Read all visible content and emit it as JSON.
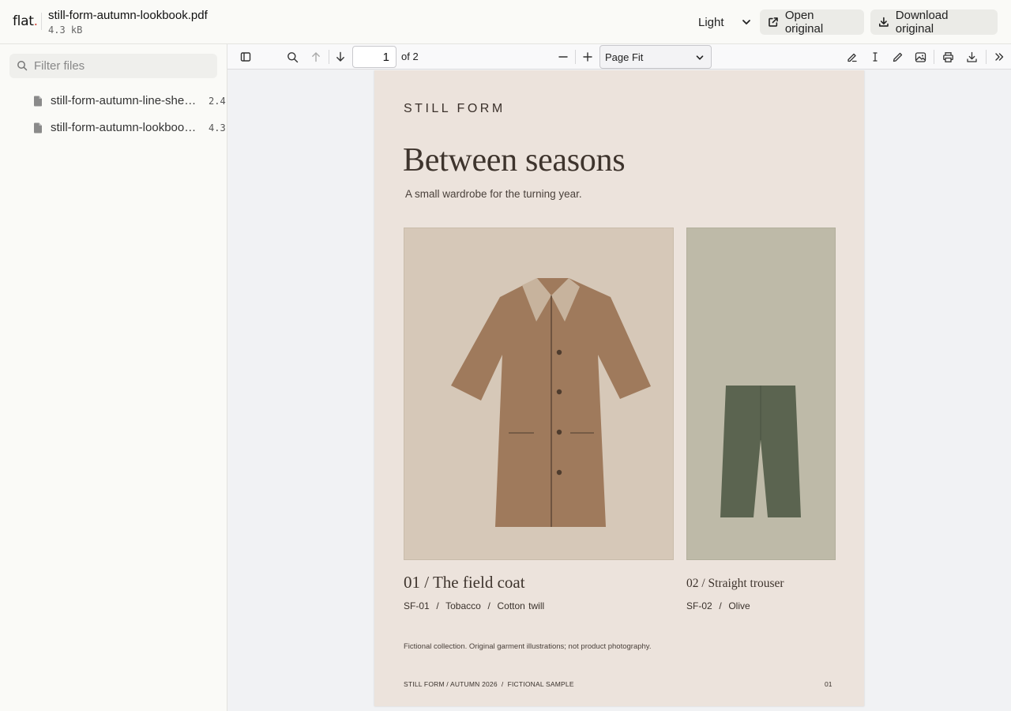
{
  "app": {
    "logo": "flat",
    "logo_dot": "."
  },
  "file": {
    "title": "still-form-autumn-lookbook.pdf",
    "size": "4.3 kB"
  },
  "header": {
    "theme_value": "Light",
    "open_label": "Open original",
    "download_label": "Download original"
  },
  "sidebar": {
    "filter_placeholder": "Filter files",
    "files": [
      {
        "name": "still-form-autumn-line-sheet.pdf",
        "size": "2.4"
      },
      {
        "name": "still-form-autumn-lookbook.pdf",
        "size": "4.3"
      }
    ]
  },
  "toolbar": {
    "page_value": "1",
    "page_of": "of 2",
    "zoom_value": "Page Fit"
  },
  "document": {
    "brand": "STILL FORM",
    "headline": "Between seasons",
    "subhead": "A small wardrobe for the turning year.",
    "items": [
      {
        "caption": "01 / The field coat",
        "spec": "SF-01  /  Tobacco  /  Cotton twill"
      },
      {
        "caption": "02 / Straight trouser",
        "spec": "SF-02  /  Olive"
      }
    ],
    "note": "Fictional collection. Original garment illustrations; not product photography.",
    "footer_left": "STILL FORM / AUTUMN 2026  /  FICTIONAL SAMPLE",
    "footer_right": "01"
  },
  "colors": {
    "page_bg": "#ece3dc",
    "coat": "#9f7a5c",
    "coat_collar": "#c7b39d",
    "trouser": "#5b6450",
    "panel_coat": "#d6c8b8",
    "panel_trouser": "#bebaa8"
  }
}
